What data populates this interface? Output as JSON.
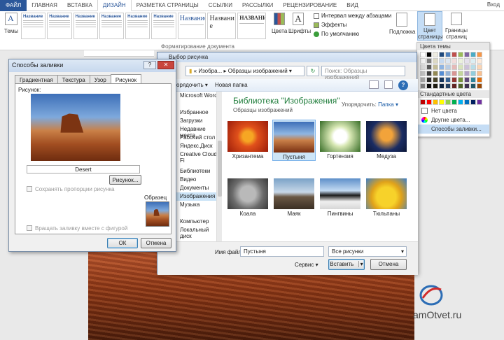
{
  "ribbon": {
    "tabs": [
      "ФАЙЛ",
      "ГЛАВНАЯ",
      "ВСТАВКА",
      "ДИЗАЙН",
      "РАЗМЕТКА СТРАНИЦЫ",
      "ССЫЛКИ",
      "РАССЫЛКИ",
      "РЕЦЕНЗИРОВАНИЕ",
      "ВИД"
    ],
    "active_tab": "ДИЗАЙН",
    "login": "Вход",
    "themes_label": "Темы",
    "style_thumbs": [
      "Название",
      "Название",
      "Название",
      "Название",
      "Название",
      "Название"
    ],
    "style_big": [
      "Название",
      "Названи е",
      "НАЗВАНИЕ"
    ],
    "group_label": "Форматирование документа",
    "colors_label": "Цвета",
    "fonts_label": "Шрифты",
    "paragraph_spacing": "Интервал между абзацами",
    "effects": "Эффекты",
    "default": "По умолчанию",
    "watermark_label": "Подложка",
    "page_color_label": "Цвет страницы",
    "page_borders_label": "Границы страниц"
  },
  "color_menu": {
    "theme_colors_head": "Цвета темы",
    "standard_colors_head": "Стандартные цвета",
    "no_color": "Нет цвета",
    "other_colors": "Другие цвета...",
    "fill_effects": "Способы заливки...",
    "theme_colors": [
      "#ffffff",
      "#000000",
      "#eeece1",
      "#1f497d",
      "#4f81bd",
      "#c0504d",
      "#9bbb59",
      "#8064a2",
      "#4bacc6",
      "#f79646"
    ],
    "theme_shades": [
      [
        "#f2f2f2",
        "#7f7f7f",
        "#ddd9c3",
        "#c6d9f0",
        "#dbe5f1",
        "#f2dcdb",
        "#ebf1dd",
        "#e5e0ec",
        "#dbeef3",
        "#fdeada"
      ],
      [
        "#d8d8d8",
        "#595959",
        "#c4bd97",
        "#8db3e2",
        "#b8cce4",
        "#e5b9b7",
        "#d7e3bc",
        "#ccc1d9",
        "#b7dde8",
        "#fbd5b5"
      ],
      [
        "#bfbfbf",
        "#3f3f3f",
        "#938953",
        "#548dd4",
        "#95b3d7",
        "#d99694",
        "#c3d69b",
        "#b2a2c7",
        "#92cddc",
        "#fac08f"
      ],
      [
        "#a5a5a5",
        "#262626",
        "#494429",
        "#17365d",
        "#366092",
        "#953734",
        "#76923c",
        "#5f497a",
        "#31859b",
        "#e36c09"
      ],
      [
        "#7f7f7f",
        "#0c0c0c",
        "#1d1b10",
        "#0f243e",
        "#244061",
        "#632423",
        "#4f6128",
        "#3f3151",
        "#205867",
        "#974806"
      ]
    ],
    "standard_colors": [
      "#c00000",
      "#ff0000",
      "#ffc000",
      "#ffff00",
      "#92d050",
      "#00b050",
      "#00b0f0",
      "#0070c0",
      "#002060",
      "#7030a0"
    ]
  },
  "fill_dialog": {
    "title": "Способы заливки",
    "tabs": [
      "Градиентная",
      "Текстура",
      "Узор",
      "Рисунок"
    ],
    "active_tab": "Рисунок",
    "picture_label": "Рисунок:",
    "picture_name": "Desert",
    "picture_button": "Рисунок...",
    "keep_aspect": "Сохранять пропорции рисунка",
    "sample_label": "Образец",
    "rotate_with_shape": "Вращать заливку вместе с фигурой",
    "ok": "ОК",
    "cancel": "Отмена",
    "help": "?",
    "close": "✕"
  },
  "picture_dialog": {
    "title": "Выбор рисунка",
    "breadcrumb_1": "Изобра...",
    "breadcrumb_2": "Образцы изображений",
    "search_placeholder": "Поиск: Образцы изображений",
    "organize": "Упорядочить",
    "new_folder": "Новая папка",
    "nav": [
      "Microsoft Word",
      "",
      "Избранное",
      "Загрузки",
      "Недавние места",
      "Рабочий стол",
      "Яндекс.Диск",
      "Creative Cloud Fi",
      "",
      "Библиотеки",
      "Видео",
      "Документы",
      "Изображения",
      "Музыка",
      "",
      "Компьютер",
      "Локальный диск"
    ],
    "library_title": "Библиотека \"Изображения\"",
    "library_sub": "Образцы изображений",
    "arrange_label": "Упорядочить:",
    "arrange_value": "Папка",
    "thumbs": [
      "Хризантема",
      "Пустыня",
      "Гортензия",
      "Медуза",
      "Коала",
      "Маяк",
      "Пингвины",
      "Тюльпаны"
    ],
    "selected_thumb": "Пустыня",
    "filename_label": "Имя файла:",
    "filename_value": "Пустыня",
    "filter_value": "Все рисунки",
    "service": "Сервис",
    "insert": "Вставить",
    "cancel": "Отмена"
  },
  "watermark": {
    "site": "amOtvet.ru"
  }
}
